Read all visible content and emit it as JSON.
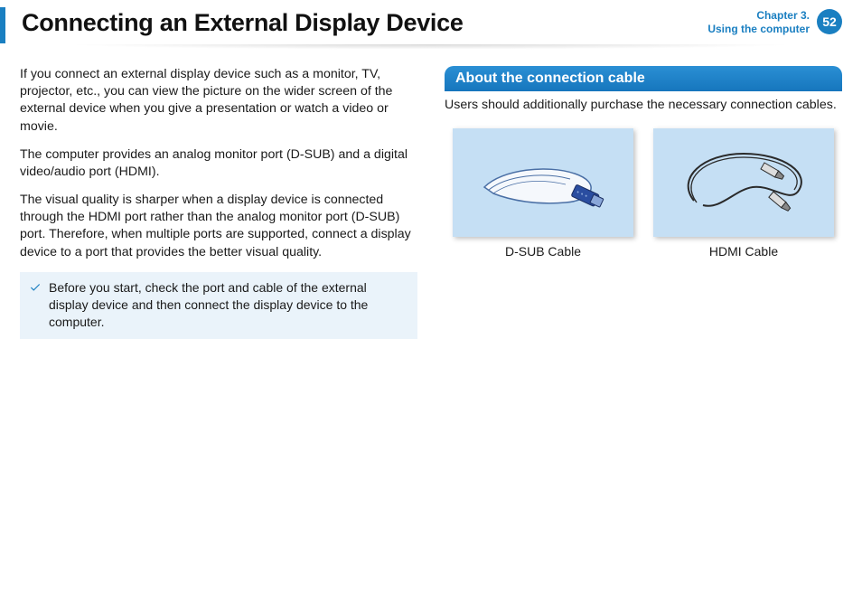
{
  "header": {
    "title": "Connecting an External Display Device",
    "chapter_line1": "Chapter 3.",
    "chapter_line2": "Using the computer",
    "page_number": "52"
  },
  "left_column": {
    "p1": "If you connect an external display device such as a monitor, TV, projector, etc., you can view the picture on the wider screen of the external device when you give a presentation or watch a video or movie.",
    "p2": "The computer provides an analog monitor port (D-SUB) and a digital video/audio port (HDMI).",
    "p3": "The visual quality is sharper when a display device is connected through the HDMI port rather than the analog monitor port (D-SUB) port. Therefore, when multiple ports are supported, connect a display device to a port that provides the better visual quality.",
    "note": "Before you start, check the port and cable of the external display device and then connect the display device to the computer."
  },
  "right_column": {
    "section_title": "About the connection cable",
    "intro": "Users should additionally purchase the necessary connection cables.",
    "cables": [
      {
        "caption": "D-SUB Cable"
      },
      {
        "caption": "HDMI Cable"
      }
    ]
  }
}
